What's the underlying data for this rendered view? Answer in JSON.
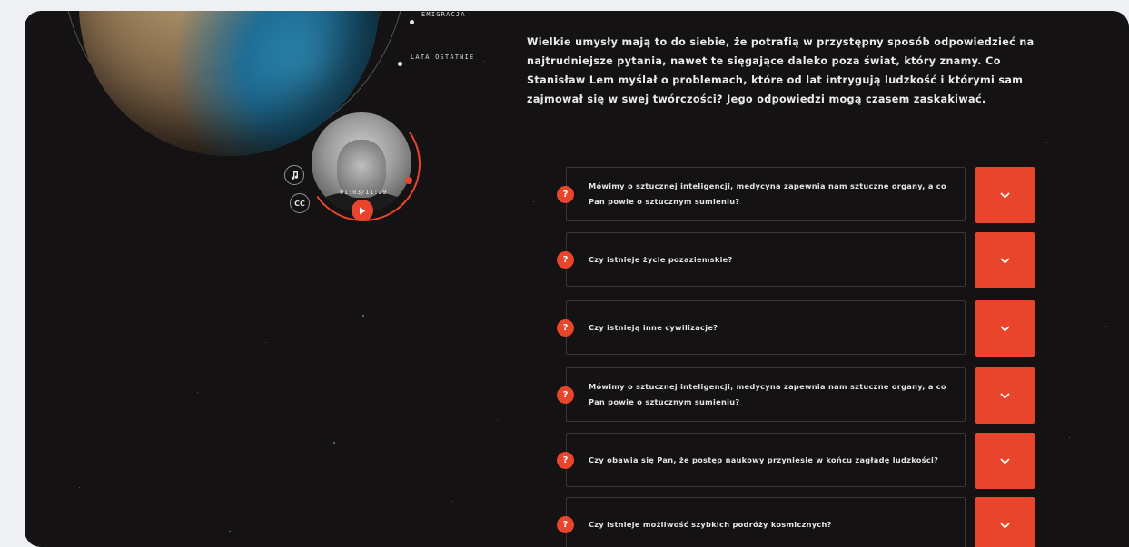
{
  "timeline": {
    "labels": [
      "EMIGRACJA",
      "LATA OSTATNIE"
    ]
  },
  "player": {
    "time": "01:03/11:29",
    "audio_icon": "music-note-icon",
    "captions_label": "CC",
    "play_icon": "play-icon",
    "accent_color": "#e8452c"
  },
  "intro": {
    "text": "Wielkie umysły mają to do siebie, że potrafią w przystępny sposób odpowiedzieć na najtrudniejsze pytania, nawet te sięgające daleko poza świat, który znamy. Co Stanisław Lem myślał o problemach, które od lat intrygują ludzkość i którymi sam zajmował się w swej twórczości? Jego odpowiedzi mogą czasem zaskakiwać."
  },
  "questions": [
    {
      "badge": "?",
      "text": "Mówimy o sztucznej inteligencji, medycyna zapewnia nam sztuczne organy, a co Pan powie o sztucznym sumieniu?"
    },
    {
      "badge": "?",
      "text": "Czy istnieje życie pozaziemskie?"
    },
    {
      "badge": "?",
      "text": "Czy istnieją inne cywilizacje?"
    },
    {
      "badge": "?",
      "text": "Mówimy o sztucznej inteligencji, medycyna zapewnia nam sztuczne organy, a co Pan powie o sztucznym sumieniu?"
    },
    {
      "badge": "?",
      "text": "Czy obawia się Pan, że postęp naukowy przyniesie w końcu zagładę ludzkości?"
    },
    {
      "badge": "?",
      "text": "Czy istnieje możliwość szybkich podróży kosmicznych?"
    }
  ],
  "colors": {
    "background": "#141212",
    "page": "#eef0f3",
    "accent": "#e8452c"
  }
}
